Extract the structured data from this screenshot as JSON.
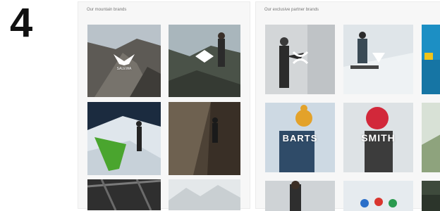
{
  "step_number": "4",
  "mountain_panel": {
    "title": "Our mountain brands",
    "brands": [
      {
        "label": "SALEWA"
      },
      {
        "label": ""
      },
      {
        "label": ""
      },
      {
        "label": ""
      },
      {
        "label": ""
      },
      {
        "label": ""
      }
    ]
  },
  "partner_panel": {
    "title": "Our exclusive partner brands",
    "brands": [
      {
        "label": ""
      },
      {
        "label": ""
      },
      {
        "label": ""
      },
      {
        "label": "BARTS"
      },
      {
        "label": "SMITH"
      },
      {
        "label": ""
      },
      {
        "label": ""
      },
      {
        "label": ""
      },
      {
        "label": ""
      }
    ]
  }
}
